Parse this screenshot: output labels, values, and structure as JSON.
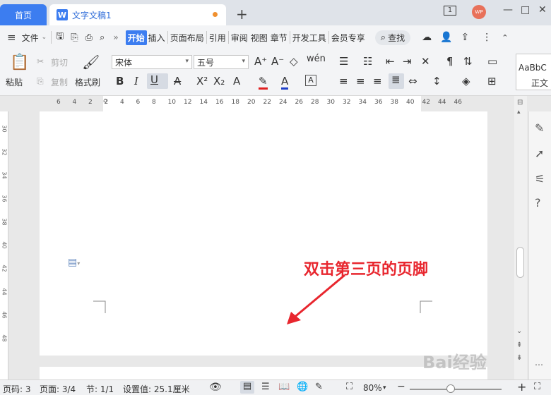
{
  "titlebar": {
    "home_tab": "首页",
    "doc_tab": "文字文稿1",
    "doc_icon": "W",
    "new_tab": "+",
    "page_badge": "1",
    "avatar": "WP",
    "minimize": "—",
    "maximize": "□",
    "close": "✕"
  },
  "menubar": {
    "hamburger": "≡",
    "file": "文件",
    "more": "»",
    "items": [
      "开始",
      "插入",
      "页面布局",
      "引用",
      "审阅",
      "视图",
      "章节",
      "开发工具",
      "会员专享"
    ],
    "search": "查找"
  },
  "ribbon": {
    "paste": "粘贴",
    "cut": "剪切",
    "copy": "复制",
    "format_painter": "格式刷",
    "font_name": "宋体",
    "font_size": "五号",
    "style_sample": "AaBbC",
    "style_name": "正文"
  },
  "ruler": {
    "ticks": [
      "6",
      "4",
      "2",
      "2",
      "4",
      "6",
      "8",
      "10",
      "12",
      "14",
      "16",
      "18",
      "20",
      "22",
      "24",
      "26",
      "28",
      "30",
      "32",
      "34",
      "36",
      "38",
      "40",
      "42",
      "44",
      "46"
    ],
    "vticks": [
      "30",
      "32",
      "34",
      "36",
      "38",
      "40",
      "42",
      "44",
      "46",
      "48"
    ]
  },
  "page": {
    "annotation": "双击第三页的页脚"
  },
  "statusbar": {
    "page_no": "页码: 3",
    "page_count": "页面: 3/4",
    "section": "节: 1/1",
    "setting": "设置值: 25.1厘米",
    "zoom": "80%",
    "zoom_minus": "−",
    "zoom_plus": "+"
  },
  "watermark": "Bai经验",
  "colors": {
    "accent": "#3c7df0",
    "annotation": "#e8262e"
  }
}
